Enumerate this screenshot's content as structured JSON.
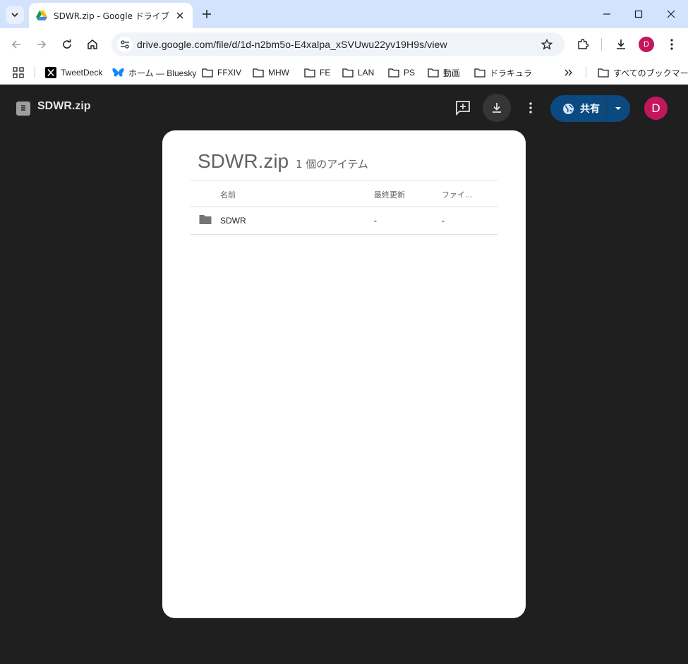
{
  "browser": {
    "tab_title": "SDWR.zip - Google ドライブ",
    "url": "drive.google.com/file/d/1d-n2bm5o-E4xalpa_xSVUwu22yv19H9s/view",
    "profile_initial": "D",
    "bookmarks": [
      {
        "label": "TweetDeck",
        "icon": "x-logo-icon"
      },
      {
        "label": "ホーム — Bluesky",
        "icon": "bluesky-butterfly-icon"
      },
      {
        "label": "FFXIV",
        "icon": "folder-icon"
      },
      {
        "label": "MHW",
        "icon": "folder-icon"
      },
      {
        "label": "FE",
        "icon": "folder-icon"
      },
      {
        "label": "LAN",
        "icon": "folder-icon"
      },
      {
        "label": "PS",
        "icon": "folder-icon"
      },
      {
        "label": "動画",
        "icon": "folder-icon"
      },
      {
        "label": "ドラキュラ",
        "icon": "folder-icon"
      }
    ],
    "all_bookmarks_label": "すべてのブックマーク"
  },
  "viewer": {
    "file_name": "SDWR.zip",
    "share_label": "共有",
    "profile_initial": "D",
    "card": {
      "title": "SDWR.zip",
      "item_count": "1 個のアイテム",
      "columns": [
        "名前",
        "最終更新",
        "ファイ..."
      ],
      "rows": [
        {
          "name": "SDWR",
          "modified": "-",
          "size": "-"
        }
      ]
    }
  },
  "colors": {
    "tabstrip": "#d3e3fd",
    "viewer_bg": "#1f1f1f",
    "share_button": "#0a4a80",
    "avatar": "#c2185b"
  }
}
